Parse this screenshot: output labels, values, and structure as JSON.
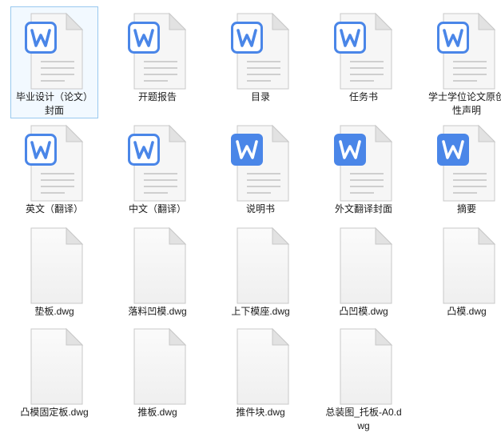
{
  "files": [
    {
      "name": "毕业设计（论文）封面",
      "type": "word-doc",
      "icon": "word-document-icon",
      "selected": true
    },
    {
      "name": "开题报告",
      "type": "word-doc",
      "icon": "word-document-icon"
    },
    {
      "name": "目录",
      "type": "word-doc",
      "icon": "word-document-icon"
    },
    {
      "name": "任务书",
      "type": "word-doc",
      "icon": "word-document-icon"
    },
    {
      "name": "学士学位论文原创性声明",
      "type": "word-doc",
      "icon": "word-document-icon"
    },
    {
      "name": "英文（翻译）",
      "type": "word-doc",
      "icon": "word-document-icon"
    },
    {
      "name": "中文（翻译）",
      "type": "word-doc",
      "icon": "word-document-icon"
    },
    {
      "name": "说明书",
      "type": "word-docx",
      "icon": "word-document-icon"
    },
    {
      "name": "外文翻译封面",
      "type": "word-docx",
      "icon": "word-document-icon"
    },
    {
      "name": "摘要",
      "type": "word-docx",
      "icon": "word-document-icon"
    },
    {
      "name": "垫板.dwg",
      "type": "blank",
      "icon": "blank-file-icon"
    },
    {
      "name": "落料凹模.dwg",
      "type": "blank",
      "icon": "blank-file-icon"
    },
    {
      "name": "上下模座.dwg",
      "type": "blank",
      "icon": "blank-file-icon"
    },
    {
      "name": "凸凹模.dwg",
      "type": "blank",
      "icon": "blank-file-icon"
    },
    {
      "name": "凸模.dwg",
      "type": "blank",
      "icon": "blank-file-icon"
    },
    {
      "name": "凸模固定板.dwg",
      "type": "blank",
      "icon": "blank-file-icon"
    },
    {
      "name": "推板.dwg",
      "type": "blank",
      "icon": "blank-file-icon"
    },
    {
      "name": "推件块.dwg",
      "type": "blank",
      "icon": "blank-file-icon"
    },
    {
      "name": "总装图_托板-A0.dwg",
      "type": "blank",
      "icon": "blank-file-icon"
    }
  ],
  "colors": {
    "word_blue": "#4a86e8",
    "word_blue_dark": "#3b78dc",
    "page_fill": "#f5f5f5",
    "page_edge": "#c8c8c8",
    "selection_border": "#99c9ef"
  }
}
